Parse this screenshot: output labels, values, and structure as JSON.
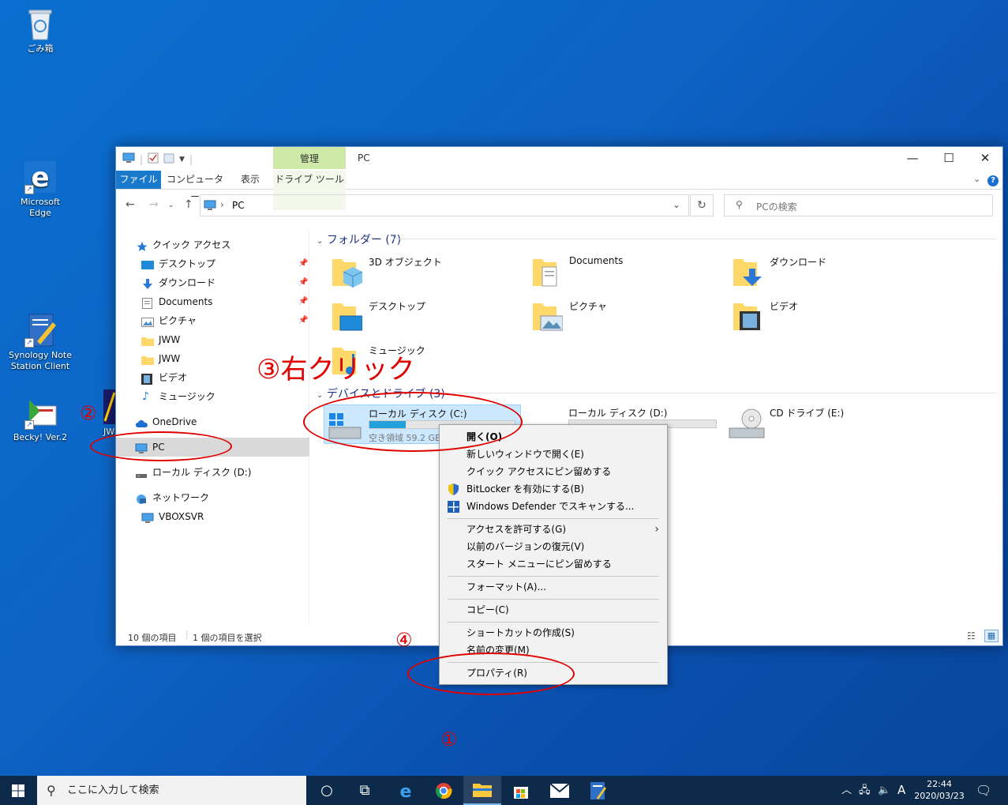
{
  "desktop": {
    "icons": [
      {
        "label": "ごみ箱",
        "icon": "recycle-bin-icon"
      },
      {
        "label": "Microsoft Edge",
        "icon": "edge-icon"
      },
      {
        "label": "Synology Note Station Client",
        "icon": "note-station-icon"
      },
      {
        "label": "Becky! Ver.2",
        "icon": "becky-mail-icon"
      },
      {
        "label": "JW",
        "icon": "jw-cad-icon"
      }
    ]
  },
  "window": {
    "title": "PC",
    "manage_tab": "管理",
    "ribbon_tabs": [
      "ファイル",
      "コンピューター",
      "表示",
      "ドライブ ツール"
    ],
    "address": "PC",
    "search_placeholder": "PCの検索",
    "caption": {
      "minimize": "—",
      "maximize": "☐",
      "close": "✕"
    }
  },
  "nav_pane": {
    "quick_access": "クイック アクセス",
    "pinned": [
      "デスクトップ",
      "ダウンロード",
      "Documents",
      "ピクチャ"
    ],
    "items": [
      "JWW",
      "JWW",
      "ビデオ",
      "ミュージック"
    ],
    "onedrive": "OneDrive",
    "pc": "PC",
    "local_disk_d": "ローカル ディスク (D:)",
    "network": "ネットワーク",
    "vboxsvr": "VBOXSVR"
  },
  "content": {
    "folders_header": "フォルダー (7)",
    "folders": [
      "3D オブジェクト",
      "Documents",
      "ダウンロード",
      "デスクトップ",
      "ピクチャ",
      "ビデオ",
      "ミュージック"
    ],
    "devices_header": "デバイスとドライブ (3)",
    "drives": [
      {
        "label": "ローカル ディスク (C:)",
        "free": "空き領域 59.2 GB/",
        "used_fraction": 0.25
      },
      {
        "label": "ローカル ディスク (D:)",
        "used_fraction": 0.0
      },
      {
        "label": "CD ドライブ (E:)"
      }
    ]
  },
  "status": {
    "count": "10 個の項目",
    "selected": "1 個の項目を選択"
  },
  "context_menu": {
    "items": [
      "開く(O)",
      "新しいウィンドウで開く(E)",
      "クイック アクセスにピン留めする",
      "BitLocker を有効にする(B)",
      "Windows Defender でスキャンする...",
      "アクセスを許可する(G)",
      "以前のバージョンの復元(V)",
      "スタート メニューにピン留めする",
      "フォーマット(A)...",
      "コピー(C)",
      "ショートカットの作成(S)",
      "名前の変更(M)",
      "プロパティ(R)"
    ]
  },
  "annotations": {
    "step1": "①",
    "step2": "②",
    "step3": "③右クリック",
    "step4": "④",
    "color": "#e00000"
  },
  "taskbar": {
    "search_text": "ここに入力して検索",
    "ime": "A",
    "time": "22:44",
    "date": "2020/03/23"
  }
}
